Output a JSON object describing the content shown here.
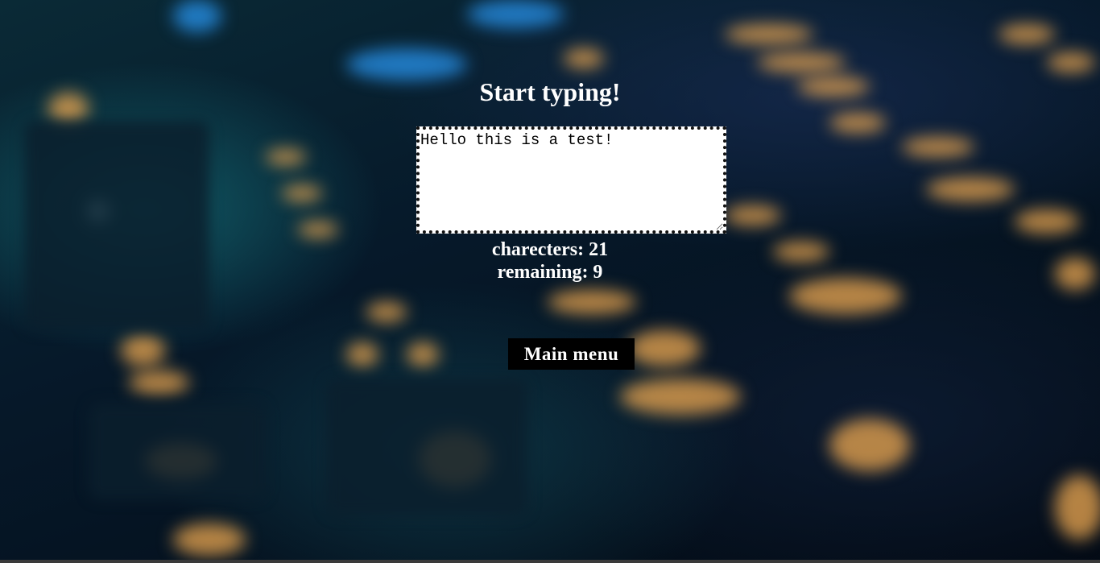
{
  "page": {
    "title": "Start typing!"
  },
  "editor": {
    "value": "Hello this is a test!"
  },
  "stats": {
    "characters_label": "charecters: 21",
    "remaining_label": "remaining: 9"
  },
  "menu": {
    "main_menu_label": "Main menu"
  },
  "icons": {
    "resize": "resize-grip-icon"
  },
  "colors": {
    "text": "#ffffff",
    "button_bg": "#000000",
    "textarea_bg": "#ffffff",
    "textarea_border": "#111111"
  }
}
